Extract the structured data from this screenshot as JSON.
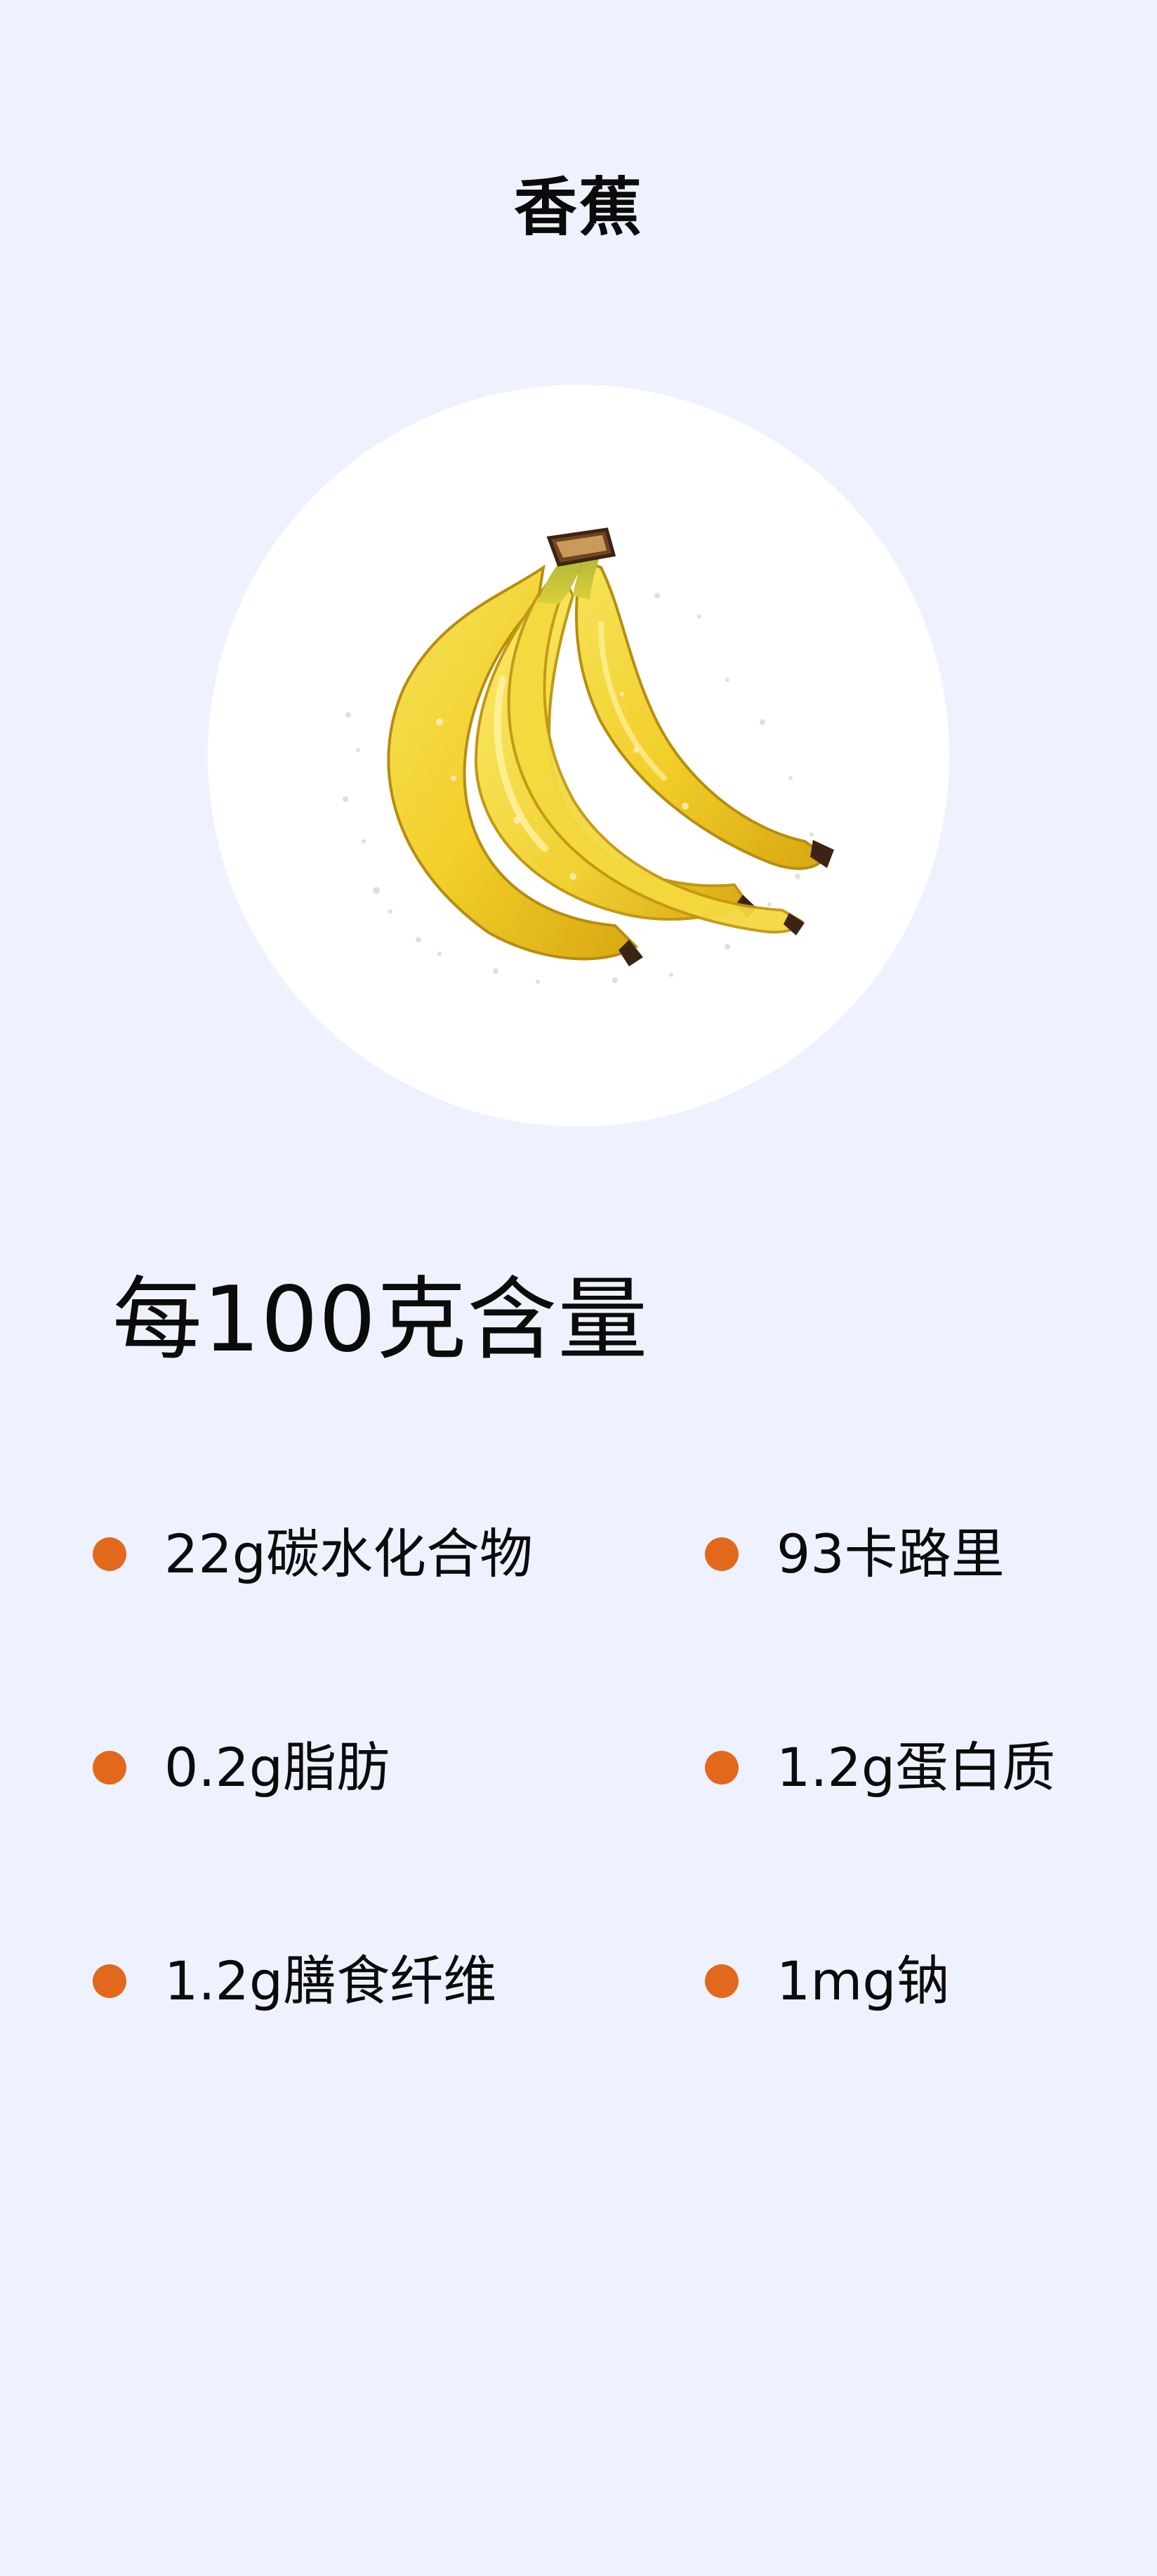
{
  "title": "香蕉",
  "image": {
    "subject": "banana-bunch"
  },
  "section_heading": "每100克含量",
  "accent_color": "#e2691c",
  "background_color": "#eef2fe",
  "nutrients": [
    {
      "label": "22g碳水化合物"
    },
    {
      "label": "93卡路里"
    },
    {
      "label": "0.2g脂肪"
    },
    {
      "label": "1.2g蛋白质"
    },
    {
      "label": "1.2g膳食纤维"
    },
    {
      "label": "1mg钠"
    }
  ]
}
